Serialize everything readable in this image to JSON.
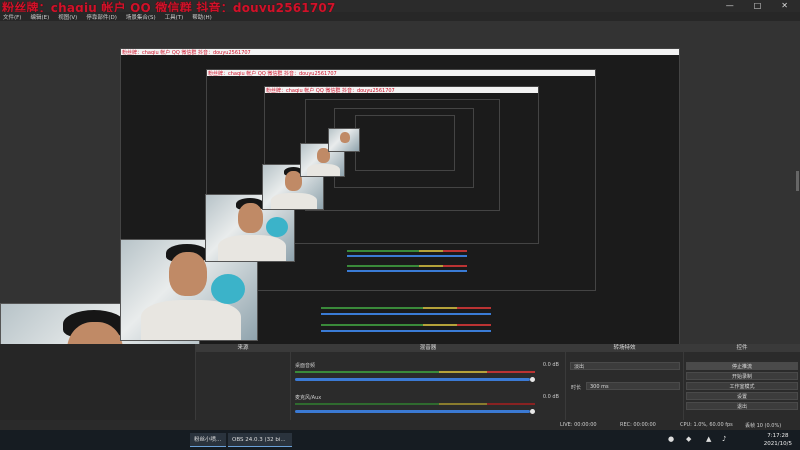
{
  "window": {
    "overlay_text": "粉丝牌：chaqiu 帐户 QQ 微信群  抖音：douyu2561707",
    "minimize": "—",
    "maximize": "□",
    "close": "✕"
  },
  "menu": [
    "文件(F)",
    "编辑(E)",
    "视图(V)",
    "停靠部件(D)",
    "场景集合(S)",
    "工具(T)",
    "帮助(H)"
  ],
  "docks": {
    "scenes_title": "来源",
    "mixer_title": "混音器",
    "transitions_title": "转场特效",
    "controls_title": "控件",
    "mixer": [
      {
        "label": "桌面音频",
        "db": "0.0 dB"
      },
      {
        "label": "麦克风/Aux",
        "db": "0.0 dB"
      }
    ],
    "transition": {
      "mode": "淡出",
      "duration_label": "时长",
      "duration_value": "300 ms"
    },
    "controls": [
      "停止推流",
      "开始录制",
      "工作室模式",
      "设置",
      "退出"
    ]
  },
  "status": {
    "live": "LIVE: 00:00:00",
    "rec": "REC: 00:00:00",
    "cpu": "CPU: 1.0%, 60.00 fps",
    "dropped": "丢帧 10 (0.0%)",
    "fps_note": "kb/s: 0"
  },
  "taskbar": {
    "items": [
      "粉丝小喷...",
      "OBS 24.0.3 (32 bi..."
    ],
    "time": "7:17:28",
    "date": "2021/10/5"
  }
}
